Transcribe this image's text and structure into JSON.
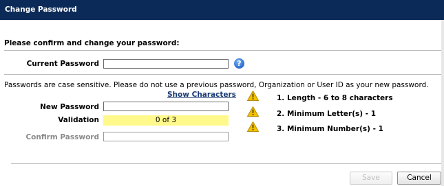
{
  "dialog": {
    "title": "Change Password",
    "heading": "Please confirm and change your password:"
  },
  "current_password": {
    "label": "Current Password",
    "value": "",
    "help_icon": "help-icon"
  },
  "note": "Passwords are case sensitive. Please do not use a previous password, Organization or User ID as your new password.",
  "show_characters": "Show Characters",
  "new_password": {
    "label": "New Password",
    "value": ""
  },
  "validation": {
    "label": "Validation",
    "value": "0 of 3",
    "color": "#fff98c"
  },
  "confirm_password": {
    "label": "Confirm Password",
    "value": ""
  },
  "requirements": [
    {
      "text": "1. Length - 6 to 8 characters",
      "icon": "warning-icon"
    },
    {
      "text": "2. Minimum Letter(s) - 1",
      "icon": "warning-icon"
    },
    {
      "text": "3. Minimum Number(s) - 1",
      "icon": "warning-icon"
    }
  ],
  "buttons": {
    "save": "Save",
    "cancel": "Cancel"
  },
  "colors": {
    "titlebar": "#0b2a57",
    "link": "#1a3a73",
    "warning": "#f2c200"
  }
}
